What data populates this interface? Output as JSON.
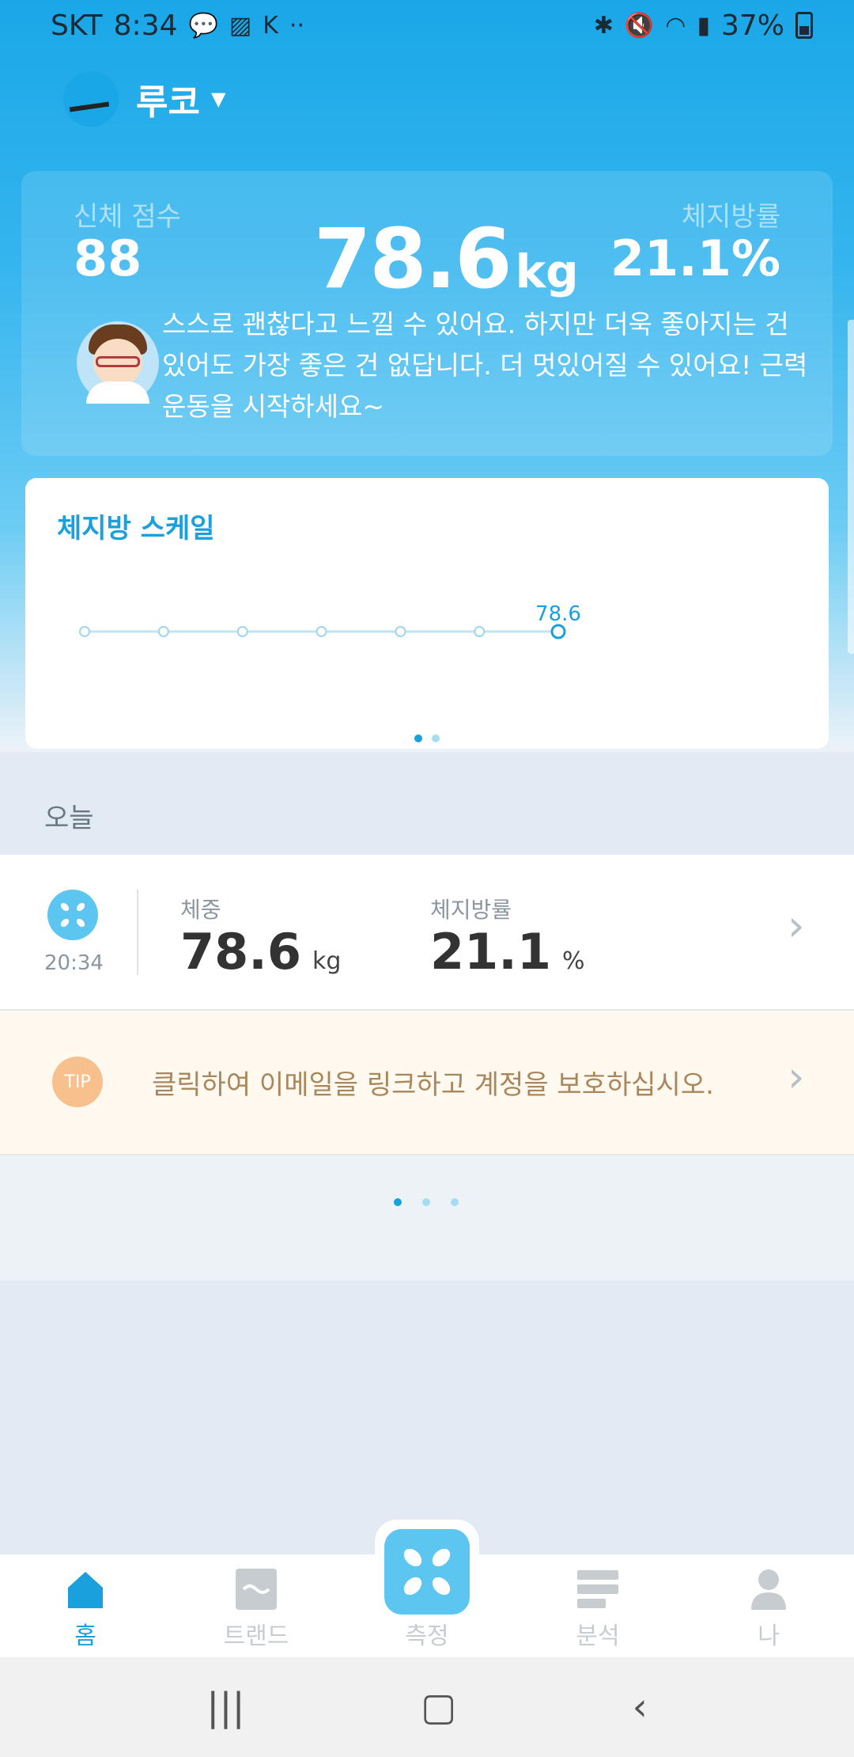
{
  "status_bar": {
    "carrier": "SKT",
    "time": "8:34",
    "battery": "37%",
    "icons_left": [
      "talk-icon",
      "image-icon",
      "app-icon",
      "more-dots-icon"
    ],
    "icons_right": [
      "bluetooth-icon",
      "mute-icon",
      "wifi-icon",
      "signal-icon",
      "battery-icon"
    ]
  },
  "profile": {
    "name": "루코"
  },
  "summary": {
    "body_score_label": "신체 점수",
    "body_score_value": "88",
    "weight_value": "78.6",
    "weight_unit": "kg",
    "body_fat_label": "체지방률",
    "body_fat_value": "21.1%",
    "advice": "스스로 괜찮다고 느낄 수 있어요. 하지만 더욱 좋아지는 건 있어도 가장 좋은 건 없답니다. 더 멋있어질 수 있어요! 근력운동을 시작하세요~"
  },
  "scale_card": {
    "title": "체지방 스케일",
    "chart_data": {
      "type": "line",
      "values": [
        null,
        null,
        null,
        null,
        null,
        null,
        78.6
      ],
      "latest_label": "78.6",
      "grid": false
    },
    "pager": {
      "count": 2,
      "active": 0
    }
  },
  "today": {
    "section_label": "오늘",
    "record": {
      "time": "20:34",
      "weight_label": "체중",
      "weight_value": "78.6",
      "weight_unit": "kg",
      "fat_label": "체지방률",
      "fat_value": "21.1",
      "fat_unit": "%"
    },
    "tip": {
      "badge": "TIP",
      "text": "클릭하여 이메일을 링크하고 계정을 보호하십시오."
    },
    "pager": {
      "count": 3,
      "active": 0
    }
  },
  "bottom_nav": {
    "items": [
      {
        "label": "홈",
        "icon": "home-icon",
        "active": true
      },
      {
        "label": "트랜드",
        "icon": "trend-icon",
        "active": false
      },
      {
        "label": "측정",
        "icon": "measure-icon",
        "active": false
      },
      {
        "label": "분석",
        "icon": "analysis-icon",
        "active": false
      },
      {
        "label": "나",
        "icon": "person-icon",
        "active": false
      }
    ]
  },
  "colors": {
    "accent": "#1aa0dd",
    "header_top": "#1aa7e8",
    "tip_bg": "#fff9ef",
    "tip_text": "#a9865b",
    "tip_badge": "#f7c08d"
  }
}
